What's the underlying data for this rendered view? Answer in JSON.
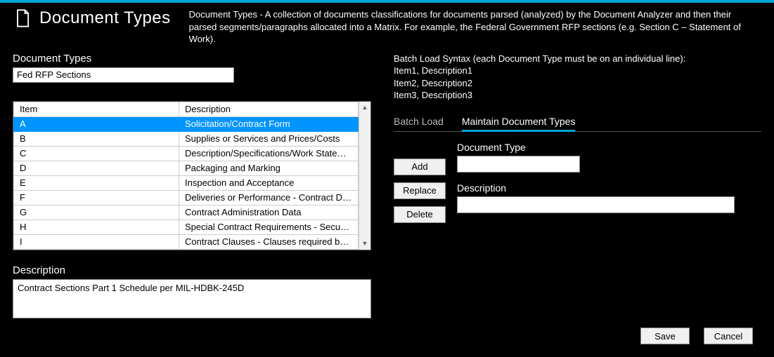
{
  "header": {
    "title": "Document Types",
    "description": "Document Types - A collection of documents classifications for documents parsed (analyzed) by the Document Analyzer and then their parsed segments/paragraphs allocated into a Matrix. For example, the Federal Government RFP sections (e.g. Section C – Statement of Work)."
  },
  "left": {
    "section_label": "Document Types",
    "name_value": "Fed RFP Sections",
    "table": {
      "headers": {
        "item": "Item",
        "description": "Description"
      },
      "rows": [
        {
          "item": "A",
          "description": "Solicitation/Contract Form",
          "selected": true
        },
        {
          "item": "B",
          "description": "Supplies or Services and Prices/Costs"
        },
        {
          "item": "C",
          "description": "Description/Specifications/Work Statemen..."
        },
        {
          "item": "D",
          "description": "Packaging and Marking"
        },
        {
          "item": "E",
          "description": "Inspection and Acceptance"
        },
        {
          "item": "F",
          "description": "Deliveries or Performance - Contract Deliv..."
        },
        {
          "item": "G",
          "description": "Contract Administration Data"
        },
        {
          "item": "H",
          "description": "Special Contract Requirements - Security ..."
        },
        {
          "item": "I",
          "description": "Contract Clauses - Clauses required by Pro..."
        }
      ]
    },
    "description_label": "Description",
    "description_value": "Contract Sections Part 1 Schedule per MIL-HDBK-245D"
  },
  "right": {
    "syntax": {
      "line1": "Batch Load Syntax (each Document Type must be on an individual line):",
      "line2": "Item1, Description1",
      "line3": "Item2, Description2",
      "line4": "Item3, Description3"
    },
    "tabs": {
      "batch": "Batch Load",
      "maintain": "Maintain Document Types"
    },
    "form": {
      "doctype_label": "Document Type",
      "description_label": "Description",
      "add": "Add",
      "replace": "Replace",
      "delete": "Delete",
      "doctype_value": "",
      "description_value": ""
    }
  },
  "footer": {
    "save": "Save",
    "cancel": "Cancel"
  }
}
